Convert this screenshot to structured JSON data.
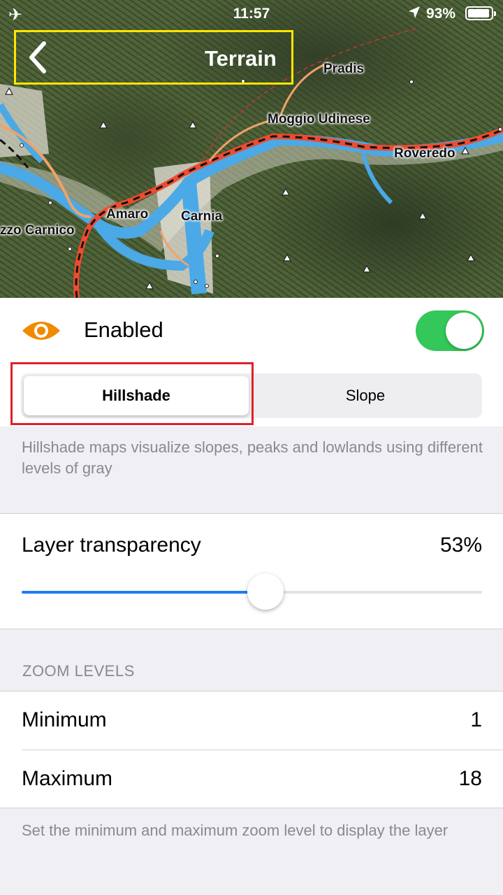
{
  "status_bar": {
    "time": "11:57",
    "battery_pct": "93%",
    "airplane_icon": "airplane-icon",
    "location_icon": "location-arrow-icon",
    "battery_icon": "battery-icon"
  },
  "nav": {
    "title": "Terrain",
    "back_icon": "chevron-left-icon"
  },
  "map": {
    "places": [
      "Pradis",
      "Moggio Udinese",
      "Roveredo",
      "Amaro",
      "Carnia",
      "zzo Carnico"
    ]
  },
  "layer": {
    "enabled_label": "Enabled",
    "enabled": true,
    "eye_icon": "eye-icon"
  },
  "mode": {
    "options": [
      "Hillshade",
      "Slope"
    ],
    "selected": "Hillshade",
    "description": "Hillshade maps visualize slopes, peaks and lowlands using different levels of gray"
  },
  "transparency": {
    "label": "Layer transparency",
    "value_text": "53%",
    "value": 0.53
  },
  "zoom": {
    "header": "ZOOM LEVELS",
    "minimum_label": "Minimum",
    "minimum_value": "1",
    "maximum_label": "Maximum",
    "maximum_value": "18",
    "description": "Set the minimum and maximum zoom level to display the layer"
  },
  "colors": {
    "accent_blue": "#1d7ef3",
    "toggle_green": "#34c759",
    "eye_orange": "#f08a00",
    "highlight_yellow": "#ffe600",
    "highlight_red": "#e0202a"
  }
}
